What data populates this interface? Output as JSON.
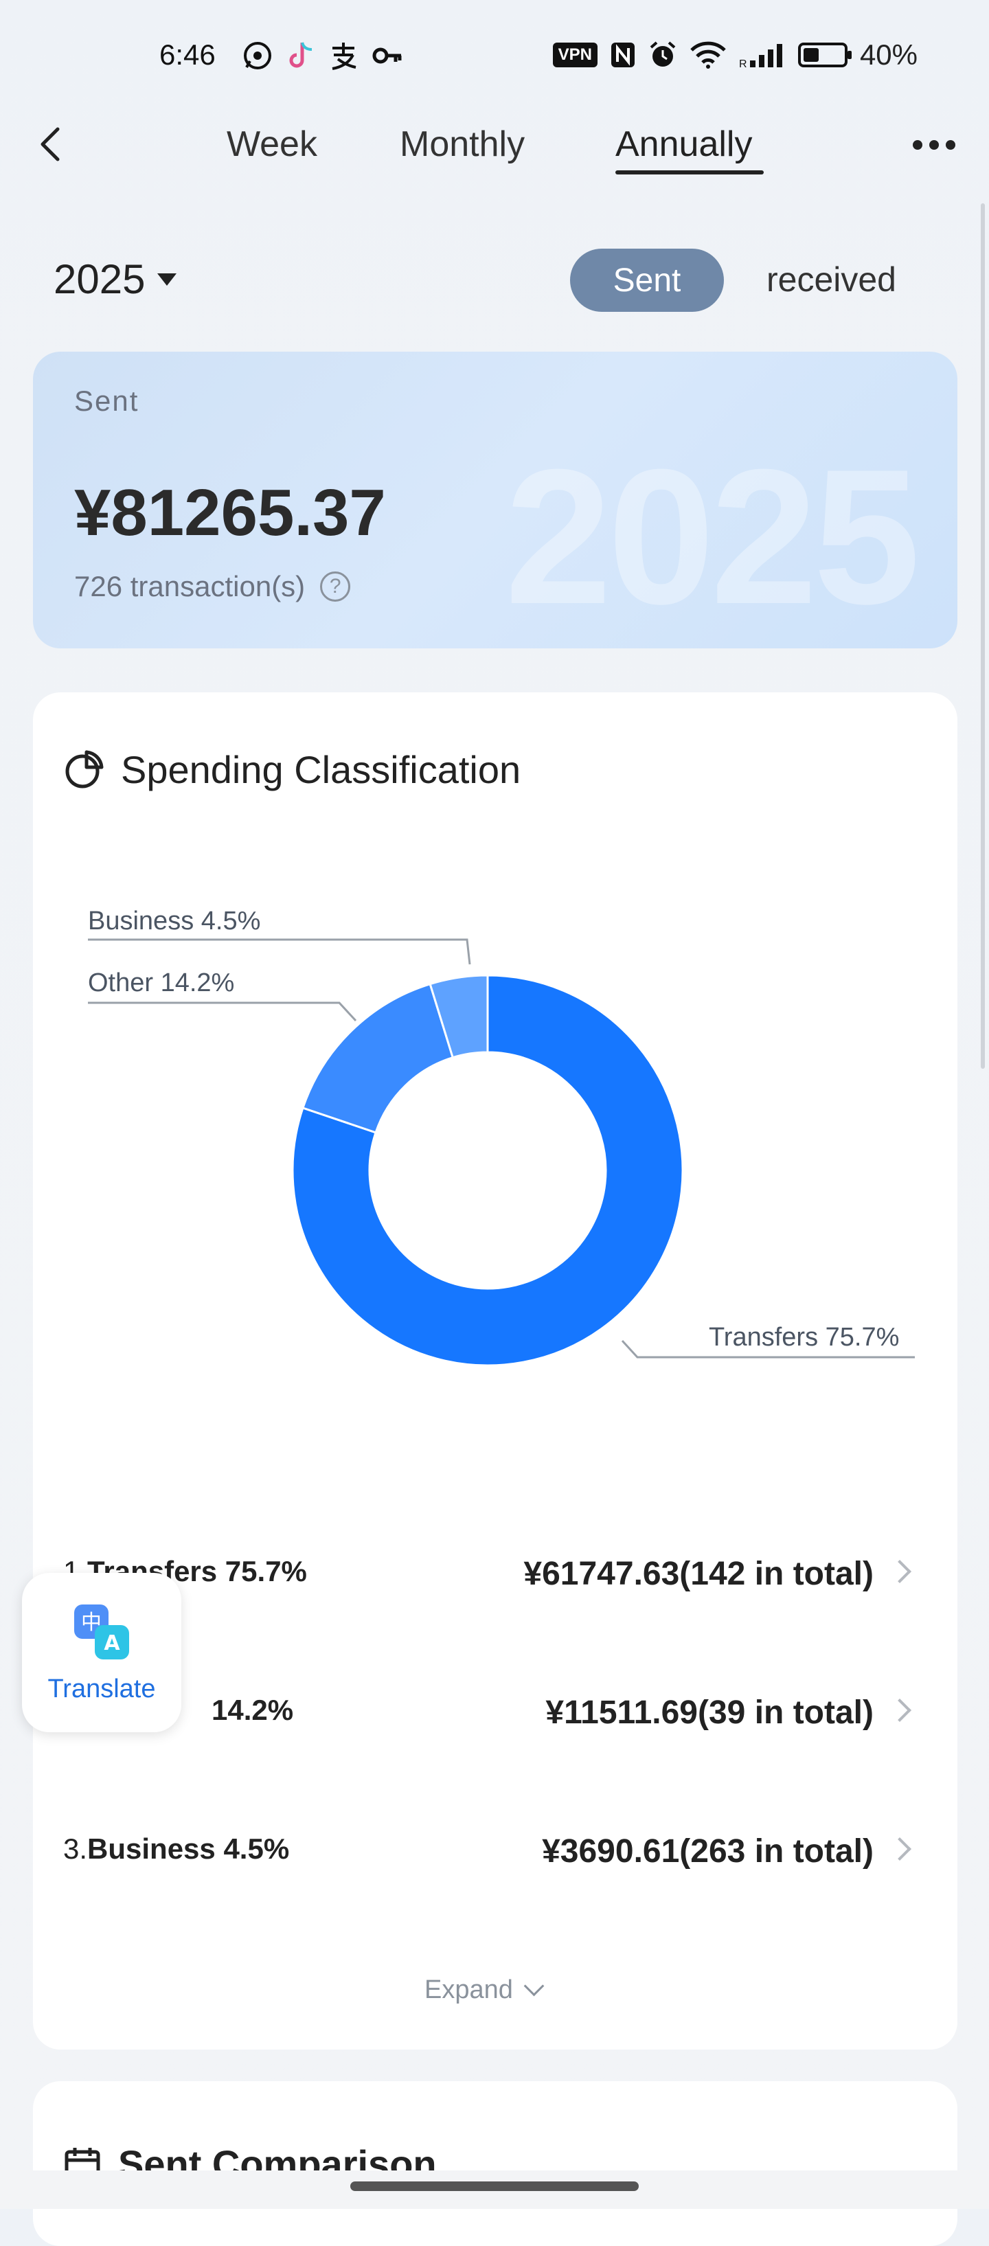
{
  "status_bar": {
    "time": "6:46",
    "vpn": "VPN",
    "battery": "40%",
    "battery_level": 0.4,
    "icons": [
      "whatsapp-icon",
      "tiktok-icon",
      "alipay-icon",
      "key-icon",
      "nfc-icon",
      "alarm-icon",
      "wifi-icon",
      "signal-icon"
    ]
  },
  "nav": {
    "tabs": [
      {
        "label": "Week"
      },
      {
        "label": "Monthly"
      },
      {
        "label": "Annually"
      }
    ],
    "active_tab": "Annually"
  },
  "filters": {
    "year": "2025",
    "sent_label": "Sent",
    "received_label": "received"
  },
  "summary": {
    "label": "Sent",
    "amount": "¥81265.37",
    "count": "726 transaction(s)",
    "watermark_year": "2025"
  },
  "classification": {
    "title": "Spending Classification",
    "pie_labels": {
      "business": "Business 4.5%",
      "other": "Other 14.2%",
      "transfers": "Transfers 75.7%"
    },
    "items": [
      {
        "index": "1.",
        "name": "Transfers 75.7%",
        "amount": "¥61747.63(142 in total)"
      },
      {
        "index": "",
        "name": "14.2%",
        "amount": "¥11511.69(39 in total)"
      },
      {
        "index": "3.",
        "name": "Business 4.5%",
        "amount": "¥3690.61(263 in total)"
      }
    ],
    "expand_label": "Expand"
  },
  "chart_data": {
    "type": "pie",
    "categories": [
      "Transfers",
      "Other",
      "Business"
    ],
    "values": [
      75.7,
      14.2,
      4.5
    ],
    "colors": [
      "#1677ff",
      "#3a8bff",
      "#5ea2ff"
    ]
  },
  "translate": {
    "label": "Translate"
  },
  "comparison": {
    "title": "Sent Comparison"
  }
}
